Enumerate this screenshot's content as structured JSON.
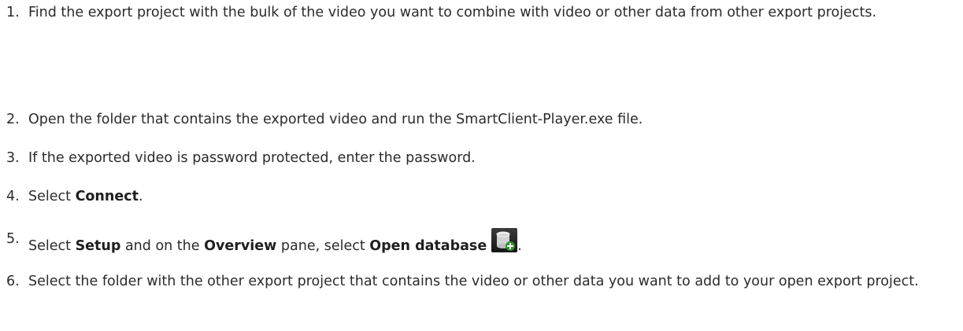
{
  "steps": [
    {
      "number": "1.",
      "text": "Find the export project with the bulk of the video you want to combine with video or other data from other export projects."
    },
    {
      "number": "2.",
      "text": "Open the folder that contains the exported video and run the SmartClient-Player.exe file."
    },
    {
      "number": "3.",
      "text": "If the exported video is password protected, enter the password."
    },
    {
      "number": "4.",
      "prefix": "Select ",
      "bold": "Connect",
      "suffix": "."
    },
    {
      "number": "5.",
      "prefix": "Select ",
      "bold1": "Setup",
      "middle1": " and on the ",
      "bold2": "Overview",
      "middle2": " pane, select ",
      "bold3": "Open database",
      "icon": "open-database-icon",
      "suffix": "."
    },
    {
      "number": "6.",
      "text": "Select the folder with the other export project that contains the video or other data you want to add to your open export project."
    }
  ]
}
